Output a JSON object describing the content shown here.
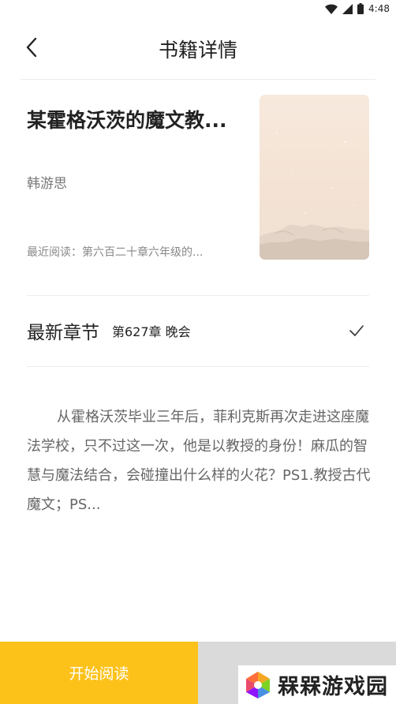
{
  "status": {
    "time": "4:48",
    "icons": [
      "wifi-icon",
      "signal-icon",
      "battery-icon"
    ]
  },
  "header": {
    "title": "书籍详情",
    "back_icon": "chevron-left-icon"
  },
  "book": {
    "title": "某霍格沃茨的魔文教...",
    "author": "韩游思",
    "recent_read": "最近阅读：第六百二十章六年级的..."
  },
  "latest": {
    "label": "最新章节",
    "chapter": "第627章 晚会",
    "icon": "check-icon"
  },
  "synopsis": "从霍格沃茨毕业三年后，菲利克斯再次走进这座魔法学校，只不过这一次，他是以教授的身份！麻瓜的智慧与魔法结合，会碰撞出什么样的火花？PS1.教授古代魔文；PS...",
  "bottom": {
    "start_label": "开始阅读"
  },
  "watermark": {
    "text": "槑槑游戏园"
  },
  "colors": {
    "accent": "#fdc21a",
    "secondary_button": "#dadada",
    "text_primary": "#222222",
    "text_secondary": "#888888"
  }
}
